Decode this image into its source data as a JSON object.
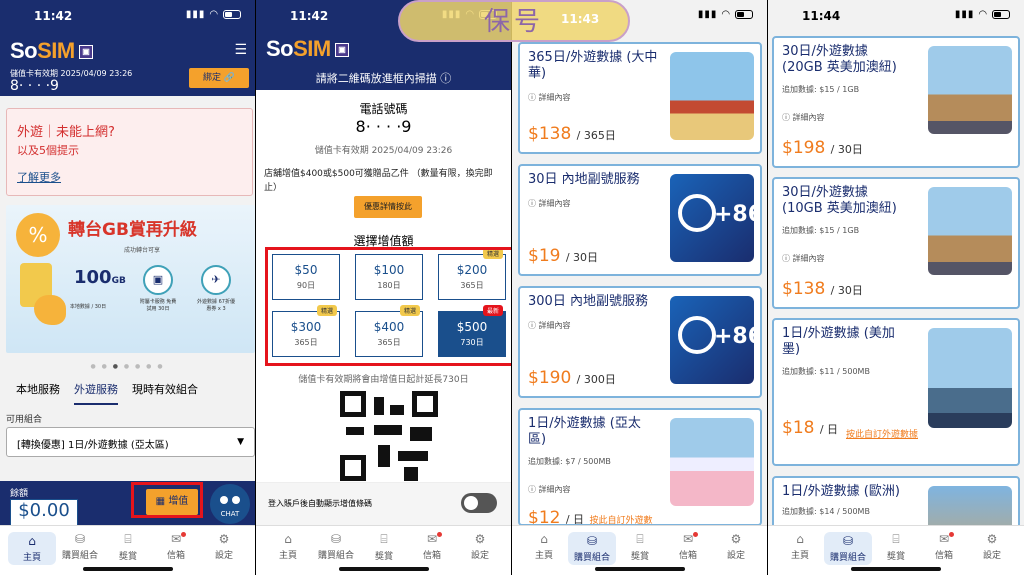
{
  "status": [
    {
      "time": "11:42"
    },
    {
      "time": "11:42"
    },
    {
      "time": "11:43"
    },
    {
      "time": "11:44"
    }
  ],
  "brand": {
    "logo_so": "So",
    "logo_sim": "SIM"
  },
  "home": {
    "expiry": "儲值卡有效期 2025/04/09 23:26",
    "phone": "8· · · ·9",
    "bind_label": "綁定",
    "alert_title": "外遊｜未能上網?",
    "alert_sub": "以及5個提示",
    "alert_link": "了解更多",
    "banner_title": "轉台GB賞再升級",
    "banner_badge": "%",
    "banner_sub": "成功轉台可享",
    "banner_100": "100",
    "banner_gb": "GB",
    "banner_items": [
      {
        "label": "本地數據 / 30日"
      },
      {
        "label": "附屬卡服務 免費試用 30日"
      },
      {
        "label": "外遊數據 67折優惠券 x 3"
      }
    ],
    "tabs": [
      "本地服務",
      "外遊服務",
      "現時有效組合"
    ],
    "plan_label": "可用組合",
    "plan_value": "[轉換優惠] 1日/外遊數據 (亞太區)",
    "balance_label": "餘額",
    "balance_value": "$0.00",
    "topup_label": "增值",
    "chat_label": "CHAT"
  },
  "tabbar": [
    "主頁",
    "購買組合",
    "獎賞",
    "信箱",
    "設定"
  ],
  "topup": {
    "scan_hint": "請將二維碼放進框內掃描",
    "phone_label": "電話號碼",
    "phone": "8· · · ·9",
    "expiry": "儲值卡有效期 2025/04/09 23:26",
    "promo": "店舖增值$400或$500可獲贈品乙件 （數量有限，換完即止）",
    "promo_btn": "優惠詳情按此",
    "select_title": "選擇增值額",
    "amounts": [
      {
        "value": "$50",
        "days": "90日",
        "tag": ""
      },
      {
        "value": "$100",
        "days": "180日",
        "tag": ""
      },
      {
        "value": "$200",
        "days": "365日",
        "tag": "精選"
      },
      {
        "value": "$300",
        "days": "365日",
        "tag": "精選"
      },
      {
        "value": "$400",
        "days": "365日",
        "tag": "精選"
      },
      {
        "value": "$500",
        "days": "730日",
        "tag": "最新"
      }
    ],
    "extend_note": "儲值卡有效期將會由增值日起計延長730日",
    "auto_show": "登入賬戶後自動顯示增值條碼"
  },
  "watermark": "保号",
  "plans_a": [
    {
      "name": "365日/外遊數據 (大中華)",
      "extra": "",
      "detail": "詳細內容",
      "price": "$138",
      "per": "/ 365日",
      "custom": ""
    },
    {
      "name": "30日 內地副號服務",
      "extra": "",
      "detail": "詳細內容",
      "price": "$19",
      "per": "/ 30日",
      "custom": ""
    },
    {
      "name": "300日 內地副號服務",
      "extra": "",
      "detail": "詳細內容",
      "price": "$190",
      "per": "/ 300日",
      "custom": ""
    },
    {
      "name": "1日/外遊數據 (亞太區)",
      "extra": "追加數據: $7 / 500MB",
      "detail": "詳細內容",
      "price": "$12",
      "per": "/ 日",
      "custom": "按此自訂外遊數"
    }
  ],
  "plus86": "+86",
  "plans_b": [
    {
      "name": "30日/外遊數據 (20GB 英美加澳紐)",
      "extra": "追加數據: $15 / 1GB",
      "detail": "詳細內容",
      "price": "$198",
      "per": "/ 30日",
      "custom": ""
    },
    {
      "name": "30日/外遊數據 (10GB 英美加澳紐)",
      "extra": "追加數據: $15 / 1GB",
      "detail": "詳細內容",
      "price": "$138",
      "per": "/ 30日",
      "custom": ""
    },
    {
      "name": "1日/外遊數據 (美加墨)",
      "extra": "追加數據: $11 / 500MB",
      "detail": "詳細內容",
      "price": "$18",
      "per": "/ 日",
      "custom": "按此自訂外遊數據"
    },
    {
      "name": "1日/外遊數據 (歐洲)",
      "extra": "追加數據: $14 / 500MB",
      "detail": "",
      "price": "",
      "per": "",
      "custom": ""
    }
  ],
  "colors": {
    "navy": "#1a2d6e",
    "orange": "#f4a12c",
    "price": "#f07c1e",
    "highlight": "#e5141c"
  }
}
